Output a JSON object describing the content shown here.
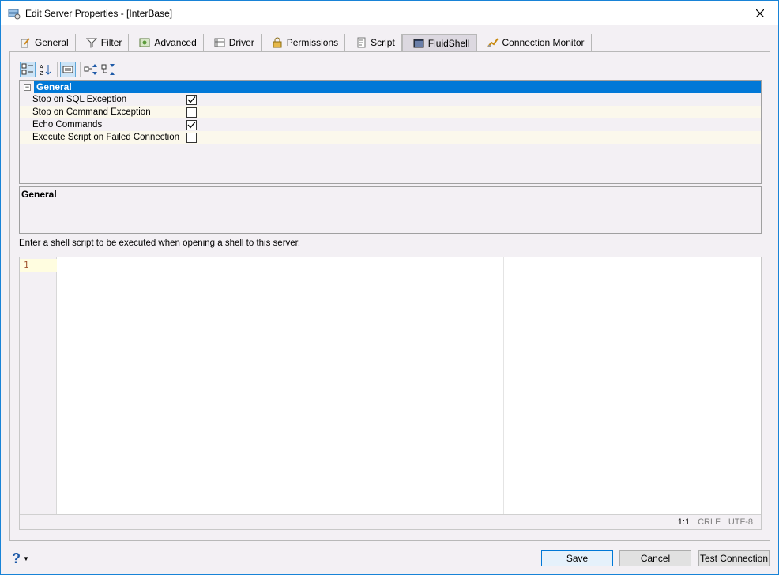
{
  "window": {
    "title": "Edit Server Properties - [InterBase]"
  },
  "tabs": [
    {
      "label": "General",
      "icon": "pencil-icon"
    },
    {
      "label": "Filter",
      "icon": "funnel-icon"
    },
    {
      "label": "Advanced",
      "icon": "gear-icon"
    },
    {
      "label": "Driver",
      "icon": "driver-icon"
    },
    {
      "label": "Permissions",
      "icon": "lock-icon"
    },
    {
      "label": "Script",
      "icon": "script-icon"
    },
    {
      "label": "FluidShell",
      "icon": "terminal-icon",
      "active": true
    },
    {
      "label": "Connection Monitor",
      "icon": "monitor-icon"
    }
  ],
  "property_grid": {
    "category": "General",
    "properties": [
      {
        "name": "Stop on SQL Exception",
        "checked": true
      },
      {
        "name": "Stop on Command Exception",
        "checked": false
      },
      {
        "name": "Echo Commands",
        "checked": true
      },
      {
        "name": "Execute Script on Failed Connection",
        "checked": false
      }
    ]
  },
  "help_panel": {
    "title": "General"
  },
  "description": "Enter a shell script to be executed when opening a shell to this server.",
  "editor": {
    "line_numbers": [
      "1"
    ],
    "status": {
      "position": "1:1",
      "line_ending": "CRLF",
      "encoding": "UTF-8"
    }
  },
  "buttons": {
    "save": "Save",
    "cancel": "Cancel",
    "test": "Test Connection"
  },
  "colors": {
    "accent": "#0078d7",
    "window_border": "#1883d7"
  }
}
